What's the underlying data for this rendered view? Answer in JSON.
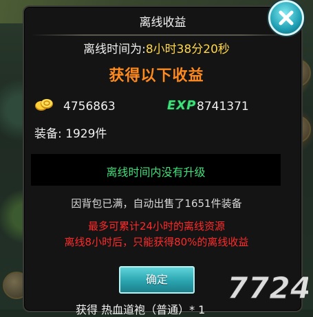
{
  "dialog": {
    "title": "离线收益",
    "offline_label": "离线时间为:",
    "offline_value": "8小时38分20秒",
    "rewards_title": "获得以下收益",
    "gold_value": "4756863",
    "exp_label": "EXP",
    "exp_value": "8741371",
    "equip_label": "装备:",
    "equip_value": "1929件",
    "notice": "离线时间内没有升级",
    "sold_text": "因背包已满，自动出售了1651件装备",
    "warning_line1": "最多可累计24小时的离线资源",
    "warning_line2": "离线8小时后，只能获得80%的离线收益",
    "confirm_label": "确定"
  },
  "bottom_text": "获得 热血道袍（普通）* 1",
  "watermark": "7724",
  "icons": {
    "close": "close-icon",
    "gold": "gold-coin-icon",
    "exp": "exp-icon"
  },
  "colors": {
    "highlight": "#ffd74a",
    "rewards_title": "#ff8a1e",
    "green": "#3fe07a",
    "warning": "#ff2a2a",
    "button": "#2aa4b0"
  }
}
